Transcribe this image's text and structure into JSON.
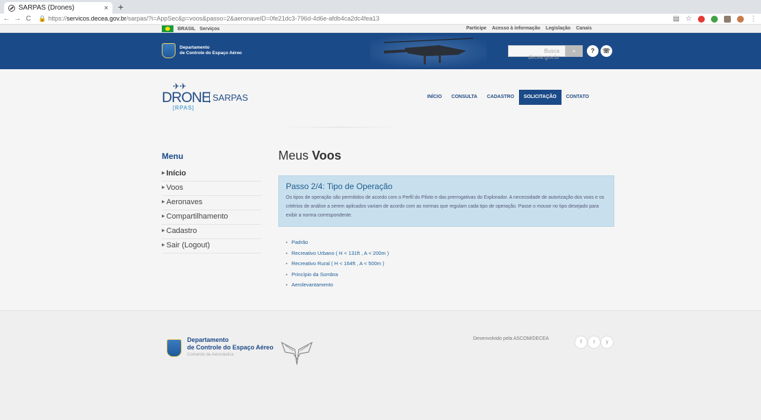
{
  "browser": {
    "tab_title": "SARPAS (Drones)",
    "tab_close": "×",
    "new_tab": "+",
    "back": "←",
    "forward": "→",
    "reload": "C",
    "url_lock": "🔒",
    "url_scheme": "https://",
    "url_host": "servicos.decea.gov.br",
    "url_path": "/sarpas/?i=AppSec&p=voos&passo=2&aeronaveID=0fe21dc3-796d-4d6e-afdb4ca2dc4fea13"
  },
  "govbar": {
    "brasil": "BRASIL",
    "servicos": "Serviços",
    "links": [
      "Participe",
      "Acesso à informação",
      "Legislação",
      "Canais"
    ]
  },
  "header": {
    "org_line1": "Departamento",
    "org_line2": "de Controle do Espaço Aéreo",
    "search_placeholder": "Busca decea.gov.br",
    "search_icon": "⌕",
    "help_icon": "?",
    "chat_icon": "☏"
  },
  "logo": {
    "drone": "DRONE",
    "sarpas": "SARPAS",
    "rpas": "[RPAS]"
  },
  "nav": {
    "items": [
      "INÍCIO",
      "CONSULTA",
      "CADASTRO",
      "SOLICITAÇÃO",
      "CONTATO"
    ],
    "active": "SOLICITAÇÃO"
  },
  "sidebar": {
    "title": "Menu",
    "items": [
      "Início",
      "Voos",
      "Aeronaves",
      "Compartilhamento",
      "Cadastro",
      "Sair (Logout)"
    ]
  },
  "main": {
    "title_prefix": "Meus ",
    "title_bold": "Voos",
    "step_title": "Passo 2/4: Tipo de Operação",
    "step_text": "Os tipos de operação são permitidos de acordo com o Perfil do Piloto e das prerrogativas do Explorador. A necessidade de autorização dos voos e os critérios de análise a serem aplicados variam de acordo com as normas que regulam cada tipo de operação. Passe o mouse no tipo desejado para exibir a norma correspondente.",
    "options": [
      "Padrão",
      "Recreativo Urbano ( H < 131ft , A < 200m )",
      "Recreativo Rural ( H < 164ft , A < 500m )",
      "Princípio da Sombra",
      "Aerolevantamento"
    ]
  },
  "footer": {
    "org_line1": "Departamento",
    "org_line2": "de Controle do Espaço Aéreo",
    "org_sub": "Comando da Aeronáutica",
    "developed_by": "Desenvolvido pela ASCOM/DECEA",
    "social": [
      "f",
      "t",
      "y"
    ]
  },
  "colors": {
    "primary": "#1b4a88",
    "info_bg": "#c8e0ee",
    "link": "#1d5e9a"
  }
}
